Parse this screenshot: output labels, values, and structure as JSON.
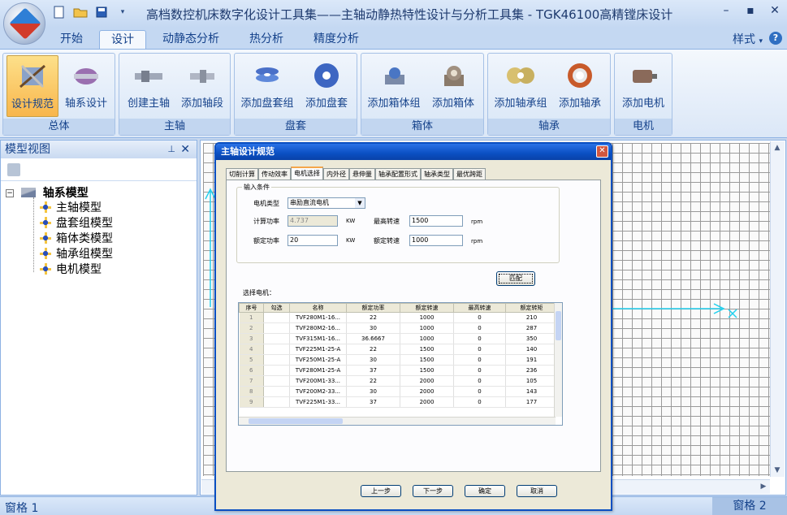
{
  "window": {
    "title": "高档数控机床数字化设计工具集——主轴动静热特性设计与分析工具集 - TGK46100高精镗床设计"
  },
  "tabs": [
    {
      "label": "开始"
    },
    {
      "label": "设计"
    },
    {
      "label": "动静态分析"
    },
    {
      "label": "热分析"
    },
    {
      "label": "精度分析"
    }
  ],
  "style_menu": "样式",
  "ribbon": {
    "groups": [
      {
        "label": "总体",
        "buttons": [
          "设计规范",
          "轴系设计"
        ]
      },
      {
        "label": "主轴",
        "buttons": [
          "创建主轴",
          "添加轴段"
        ]
      },
      {
        "label": "盘套",
        "buttons": [
          "添加盘套组",
          "添加盘套"
        ]
      },
      {
        "label": "箱体",
        "buttons": [
          "添加箱体组",
          "添加箱体"
        ]
      },
      {
        "label": "轴承",
        "buttons": [
          "添加轴承组",
          "添加轴承"
        ]
      },
      {
        "label": "电机",
        "buttons": [
          "添加电机"
        ]
      }
    ]
  },
  "left_panel": {
    "title": "模型视图",
    "tree_root": "轴系模型",
    "tree_items": [
      "主轴模型",
      "盘套组模型",
      "箱体类模型",
      "轴承组模型",
      "电机模型"
    ]
  },
  "status": {
    "left": "窗格 1",
    "right": "窗格 2"
  },
  "dialog": {
    "title": "主轴设计规范",
    "tabs": [
      "切削计算",
      "传动效率",
      "电机选择",
      "内外径",
      "悬伸量",
      "轴承配置形式",
      "轴承类型",
      "最优跨距"
    ],
    "fieldset_legend": "输入条件",
    "motor_type_label": "电机类型",
    "motor_type_value": "串励直流电机",
    "calc_power_label": "计算功率",
    "calc_power_value": "4.737",
    "max_speed_label": "最高转速",
    "max_speed_value": "1500",
    "rated_power_label": "额定功率",
    "rated_power_value": "20",
    "rated_speed_label": "额定转速",
    "rated_speed_value": "1000",
    "unit_kw": "KW",
    "unit_rpm": "rpm",
    "match_button": "匹配",
    "select_label": "选择电机：",
    "table": {
      "headers": [
        "序号",
        "勾选",
        "名称",
        "额定功率",
        "额定转速",
        "最高转速",
        "额定转矩"
      ],
      "rows": [
        [
          "1",
          "",
          "TVF280M1-16...",
          "22",
          "1000",
          "0",
          "210"
        ],
        [
          "2",
          "",
          "TVF280M2-16...",
          "30",
          "1000",
          "0",
          "287"
        ],
        [
          "3",
          "",
          "TVF315M1-16...",
          "36.6667",
          "1000",
          "0",
          "350"
        ],
        [
          "4",
          "",
          "TVF225M1-25-A",
          "22",
          "1500",
          "0",
          "140"
        ],
        [
          "5",
          "",
          "TVF250M1-25-A",
          "30",
          "1500",
          "0",
          "191"
        ],
        [
          "6",
          "",
          "TVF280M1-25-A",
          "37",
          "1500",
          "0",
          "236"
        ],
        [
          "7",
          "",
          "TVF200M1-33...",
          "22",
          "2000",
          "0",
          "105"
        ],
        [
          "8",
          "",
          "TVF200M2-33...",
          "30",
          "2000",
          "0",
          "143"
        ],
        [
          "9",
          "",
          "TVF225M1-33...",
          "37",
          "2000",
          "0",
          "177"
        ]
      ]
    },
    "buttons": {
      "prev": "上一步",
      "next": "下一步",
      "ok": "确定",
      "cancel": "取消"
    }
  }
}
